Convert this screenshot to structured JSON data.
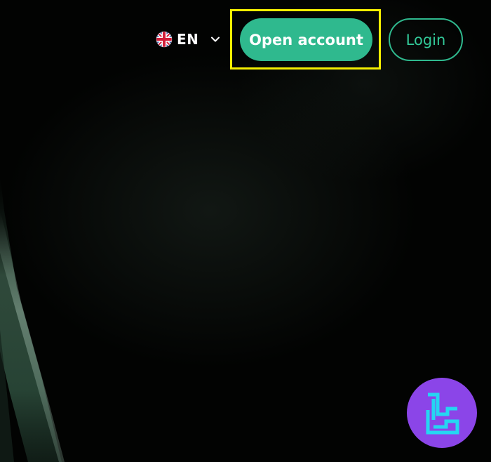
{
  "header": {
    "language": {
      "flag_icon": "uk-flag-icon",
      "code": "EN",
      "chevron_icon": "chevron-down-icon"
    },
    "open_account_label": "Open account",
    "login_label": "Login"
  },
  "colors": {
    "brand_green": "#2fb98e",
    "highlight": "#f5ef00",
    "logo_badge": "#8b45e8",
    "logo_mark": "#25d6f2"
  },
  "watermark": {
    "icon": "tc-logo-icon"
  }
}
